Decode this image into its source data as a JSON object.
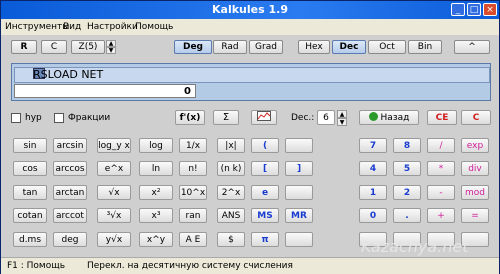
{
  "window": {
    "title": "Kalkules 1.9"
  },
  "menu": [
    "Инструменты",
    "Вид",
    "Настройки",
    "Помощь"
  ],
  "toolbar": {
    "r": "R",
    "c": "C",
    "z": "Z(5)",
    "deg": "Deg",
    "rad": "Rad",
    "grad": "Grad",
    "hex": "Hex",
    "dec": "Dec",
    "oct": "Oct",
    "bin": "Bin",
    "collapse": "^"
  },
  "display": {
    "expression": "RSLOAD NET",
    "result": "0"
  },
  "options": {
    "hyp": "hyp",
    "fractions": "Фракции",
    "dec_label": "Dec.:",
    "dec_value": "6",
    "back": "Назад",
    "ce": "CE",
    "c": "C"
  },
  "rows": [
    [
      "sin",
      "arcsin",
      "log_y x",
      "log",
      "1/x",
      "|x|",
      "(",
      "",
      "7",
      "8",
      "9",
      "/",
      "exp"
    ],
    [
      "cos",
      "arccos",
      "e^x",
      "ln",
      "n!",
      "(n k)",
      "[",
      "]",
      "4",
      "5",
      "6",
      "*",
      "div"
    ],
    [
      "tan",
      "arctan",
      "√x",
      "x²",
      "10^x",
      "2^x",
      "e",
      "",
      "1",
      "2",
      "3",
      "-",
      "mod"
    ],
    [
      "cotan",
      "arccot",
      "³√x",
      "x³",
      "ran",
      "ANS",
      "MS",
      "MR",
      "0",
      ".",
      "%",
      "+",
      "="
    ],
    [
      "d.ms",
      "deg",
      "y√x",
      "x^y",
      "A E",
      "$",
      "π",
      "",
      "",
      "",
      "",
      "",
      ""
    ]
  ],
  "status": {
    "left": "F1 : Помощь",
    "right": "Перекл. на десятичную систему счисления"
  },
  "watermark": "Kazachya.net"
}
